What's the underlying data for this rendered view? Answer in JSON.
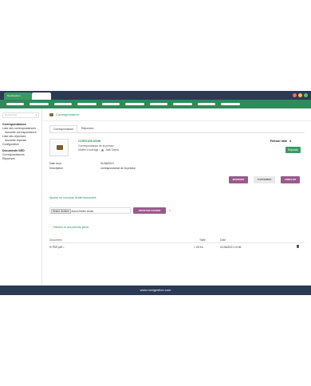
{
  "app": {
    "tab_label": "NextGestion"
  },
  "sidebar": {
    "search_placeholder": "Rechercher",
    "items": [
      {
        "label": "Correspondances",
        "bold": true
      },
      {
        "label": "Liste des correspondances"
      },
      {
        "label": "Nouvelle correspondance"
      },
      {
        "label": "Liste des réponses"
      },
      {
        "label": "Nouvelle réponse"
      },
      {
        "label": "Configuration"
      },
      {
        "label": "Documents GED",
        "bold": true
      },
      {
        "label": "Correspondances"
      },
      {
        "label": "Réponses"
      }
    ]
  },
  "breadcrumb": {
    "label": "Correspondance"
  },
  "tabs": [
    {
      "label": "Correspondance"
    },
    {
      "label": "Réponses"
    }
  ],
  "record": {
    "reference": "COR2106-0008",
    "subtitle": "Correspondance de la presse",
    "maitre_label": "Maître d'ouvrage :",
    "maitre_value": "Jack David",
    "retour_label": "Retour tâte",
    "retour_value": "4",
    "status_badge": "Répondu"
  },
  "fields": [
    {
      "label": "Date reçu",
      "value": "01/06/2021"
    },
    {
      "label": "Description",
      "value": "correspondance de la presse"
    }
  ],
  "actions": {
    "modify": "MODIFIER",
    "delete": "SUPPRIMER",
    "cancel": "ANNULER"
  },
  "upload": {
    "section_title": "Ajouter un nouveau fichier/document",
    "choose_button": "Select. fichiers",
    "no_file": "Aucun fichier choisi",
    "send_button": "ENVOYER FICHIER"
  },
  "attachments": {
    "title": "Fichiers et documents joints",
    "columns": {
      "document": "Document",
      "size": "Taille",
      "date": "Date"
    },
    "rows": [
      {
        "name": "PDF.pdf",
        "size": "< 25 Ko",
        "date": "01/06/2021 10:36"
      }
    ]
  },
  "footer": {
    "text": "www.nextgestion.com"
  },
  "colors": {
    "brand_green": "#2f8a5a",
    "navy": "#2b3a55",
    "purple": "#9a5a8c"
  }
}
